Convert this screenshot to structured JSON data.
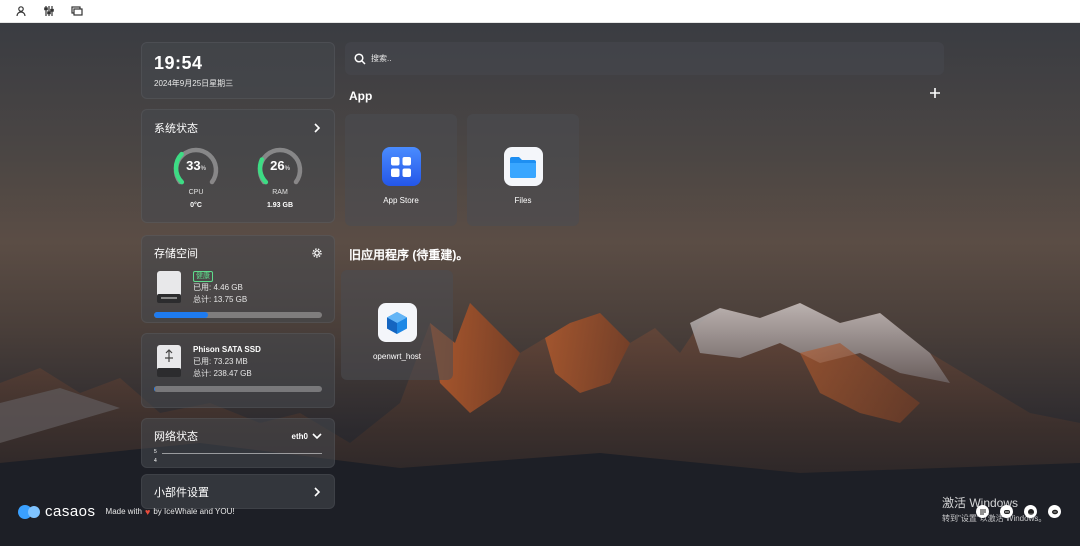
{
  "toolbar": {
    "icons": [
      "user-icon",
      "sliders-icon",
      "windows-icon"
    ]
  },
  "clock": {
    "time": "19:54",
    "date": "2024年9月25日星期三"
  },
  "system_status": {
    "title": "系统状态",
    "cpu": {
      "value": "33",
      "unit": "%",
      "label": "CPU",
      "sub": "0°C",
      "fraction": 0.33
    },
    "ram": {
      "value": "26",
      "unit": "%",
      "label": "RAM",
      "sub": "1.93 GB",
      "fraction": 0.26
    },
    "gauge_color": "#3ddc84"
  },
  "storage": {
    "title": "存储空间",
    "health_badge": "健康",
    "used": "已用: 4.46 GB",
    "total": "总计: 13.75 GB",
    "used_fraction": 0.32
  },
  "ssd": {
    "name": "Phison SATA SSD",
    "used": "已用: 73.23 MB",
    "total": "总计: 238.47 GB",
    "used_fraction": 0.003
  },
  "network": {
    "title": "网络状态",
    "interface": "eth0",
    "axis_top": "5",
    "axis_bottom": "4"
  },
  "widget_settings": {
    "label": "小部件设置"
  },
  "search": {
    "placeholder": "搜索.."
  },
  "apps": {
    "section_title": "App",
    "items": [
      {
        "label": "App Store",
        "icon": "app-store-icon",
        "color": "#2f6bff"
      },
      {
        "label": "Files",
        "icon": "folder-icon",
        "color": "#1e8ff2"
      }
    ]
  },
  "legacy_apps": {
    "section_title": "旧应用程序 (待重建)。",
    "items": [
      {
        "label": "openwrt_host",
        "icon": "cube-icon",
        "color": "#1e88e5"
      }
    ]
  },
  "watermark": {
    "line1": "激活 Windows",
    "line2": "转到\"设置\"以激活 Windows。"
  },
  "footer": {
    "logo": "casaos",
    "made_with": "Made with",
    "by": "by IceWhale and YOU!"
  },
  "social_icons": [
    "chat-icon",
    "discord-icon",
    "github-icon",
    "message-icon"
  ],
  "colors": {
    "accent_blue": "#1e7bf0",
    "health_green": "#5fdc8c",
    "heart_red": "#e74c3c"
  }
}
